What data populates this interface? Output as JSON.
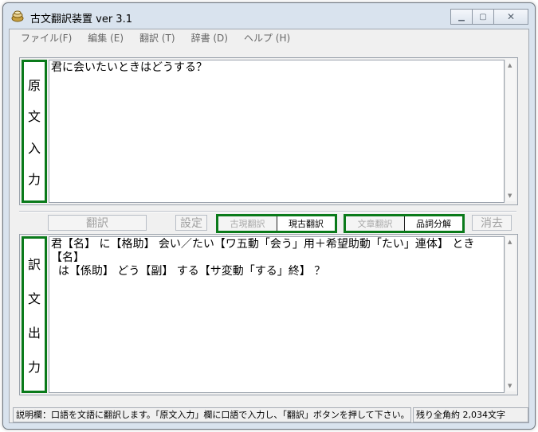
{
  "window": {
    "title": "古文翻訳装置 ver 3.1"
  },
  "menu": [
    "ファイル(F)",
    "編集 (E)",
    "翻訳 (T)",
    "辞書 (D)",
    "ヘルプ (H)"
  ],
  "input_panel": {
    "label_chars": [
      "原",
      "文",
      "入",
      "力"
    ],
    "text": "君に会いたいときはどうする？"
  },
  "toolbar": {
    "translate_label": "翻訳",
    "settings_label": "設定",
    "mode_group": {
      "left": "古現翻訳",
      "right": "現古翻訳"
    },
    "analysis_group": {
      "left": "文章翻訳",
      "right": "品詞分解"
    },
    "clear_label": "消去"
  },
  "output_panel": {
    "label_chars": [
      "訳",
      "文",
      "出",
      "力"
    ],
    "text": "君【名】 に【格助】 会い／たい【ワ五動「会う」用＋希望助動「たい」連体】 とき【名】\n  は【係助】 どう【副】 する【サ変動「する」終】 ？"
  },
  "status": {
    "left": "説明欄：口語を文語に翻訳します。「原文入力」欄に口語で入力し、「翻訳」ボタンを押して下さい。",
    "right": "残り全角約 2,034文字"
  }
}
